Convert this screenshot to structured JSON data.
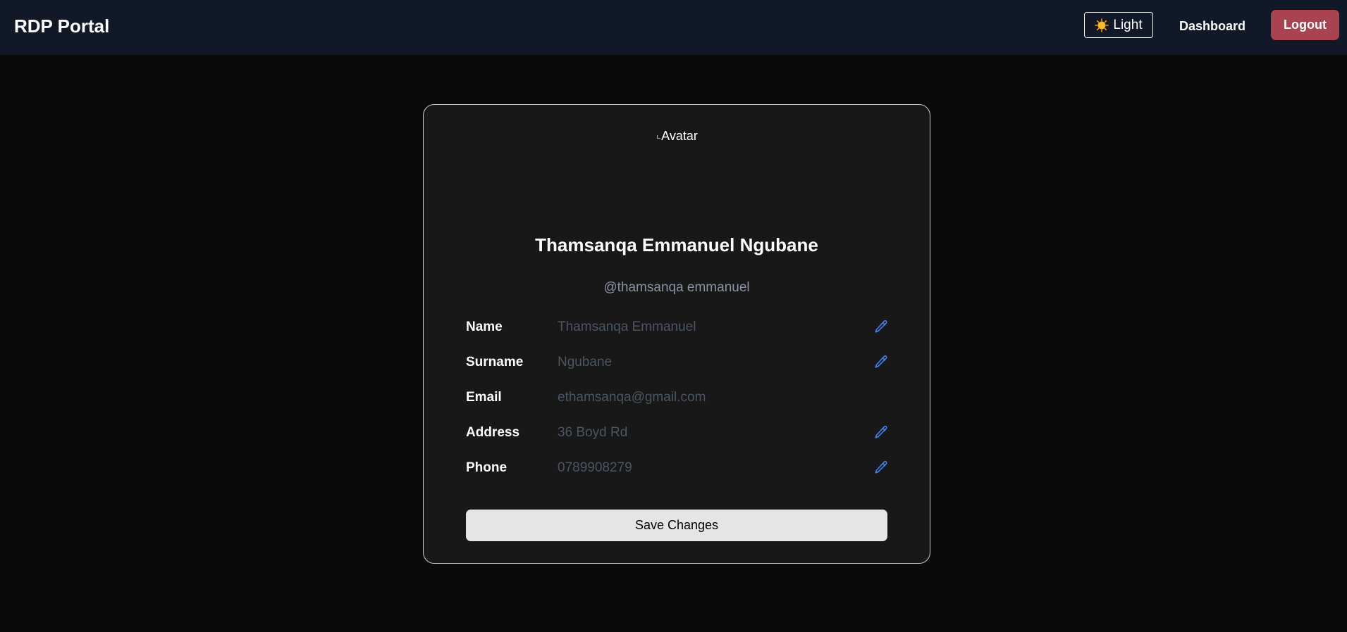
{
  "header": {
    "brand": "RDP Portal",
    "theme_toggle": {
      "label": "Light",
      "icon": "sun-icon"
    },
    "nav_link": "Dashboard",
    "logout_label": "Logout"
  },
  "profile": {
    "avatar_alt": "Avatar",
    "full_name": "Thamsanqa Emmanuel Ngubane",
    "username": "@thamsanqa emmanuel",
    "fields": [
      {
        "label": "Name",
        "value": "Thamsanqa Emmanuel",
        "editable": true
      },
      {
        "label": "Surname",
        "value": "Ngubane",
        "editable": true
      },
      {
        "label": "Email",
        "value": "ethamsanqa@gmail.com",
        "editable": false
      },
      {
        "label": "Address",
        "value": "36 Boyd Rd",
        "editable": true
      },
      {
        "label": "Phone",
        "value": "0789908279",
        "editable": true
      }
    ],
    "save_label": "Save Changes"
  },
  "colors": {
    "navbar_bg": "#111827",
    "page_bg": "#0a0a0a",
    "card_bg": "#181818",
    "logout_bg": "#a8434f",
    "edit_icon": "#3b82f6",
    "field_value": "#4b5563",
    "username": "#8a93a3"
  }
}
